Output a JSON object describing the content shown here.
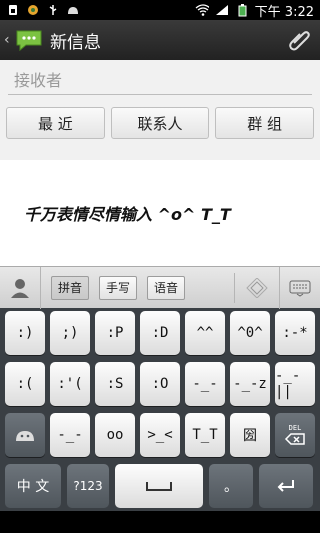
{
  "status": {
    "time": "下午 3:22",
    "left_icons": [
      "sim-icon",
      "browser-icon",
      "usb-icon",
      "android-icon"
    ],
    "right_icons": [
      "wifi-icon",
      "signal-icon",
      "battery-icon"
    ]
  },
  "titlebar": {
    "title": "新信息"
  },
  "compose": {
    "recipient_placeholder": "接收者",
    "buttons": [
      "最 近",
      "联系人",
      "群 组"
    ]
  },
  "message": {
    "text": "千万表情尽情输入 ^o^  T_T"
  },
  "keyboard": {
    "tabs": [
      "拼音",
      "手写",
      "语音"
    ],
    "rows": [
      [
        ":)",
        ";)",
        ":P",
        ":D",
        "^^",
        "^0^",
        ":-*"
      ],
      [
        ":(",
        ":'(",
        ":S",
        ":O",
        "-_-",
        "-_-z",
        "-_-||"
      ],
      [
        "android",
        "-_-",
        "oo",
        ">_<",
        "T_T",
        "圀",
        "DEL"
      ]
    ],
    "bottom": {
      "lang": "中 文",
      "num": "?123",
      "space": "space",
      "dot": "。",
      "enter": "enter"
    }
  }
}
